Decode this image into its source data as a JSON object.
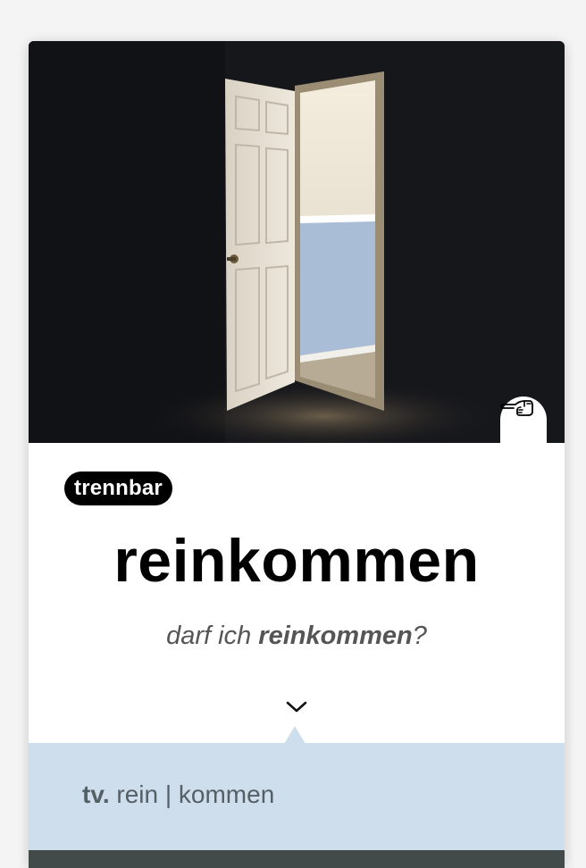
{
  "card": {
    "image_alt": "open door in a dark room",
    "badge_label": "trennbar",
    "word": "reinkommen",
    "example": {
      "prefix": "darf ich ",
      "highlight": "reinkommen",
      "suffix": "?"
    },
    "hand_button_icon": "pointing-hand-icon",
    "expand_icon": "chevron-down-icon"
  },
  "info": {
    "abbreviation": "tv.",
    "split_form": "rein | kommen"
  },
  "colors": {
    "photo_dark": "#16171b",
    "badge_bg": "#000000",
    "info_panel": "#cfdeec",
    "bottom_bar": "#424b4a",
    "door": "#e8e2d6",
    "wall_lower": "#a9bdd6"
  }
}
